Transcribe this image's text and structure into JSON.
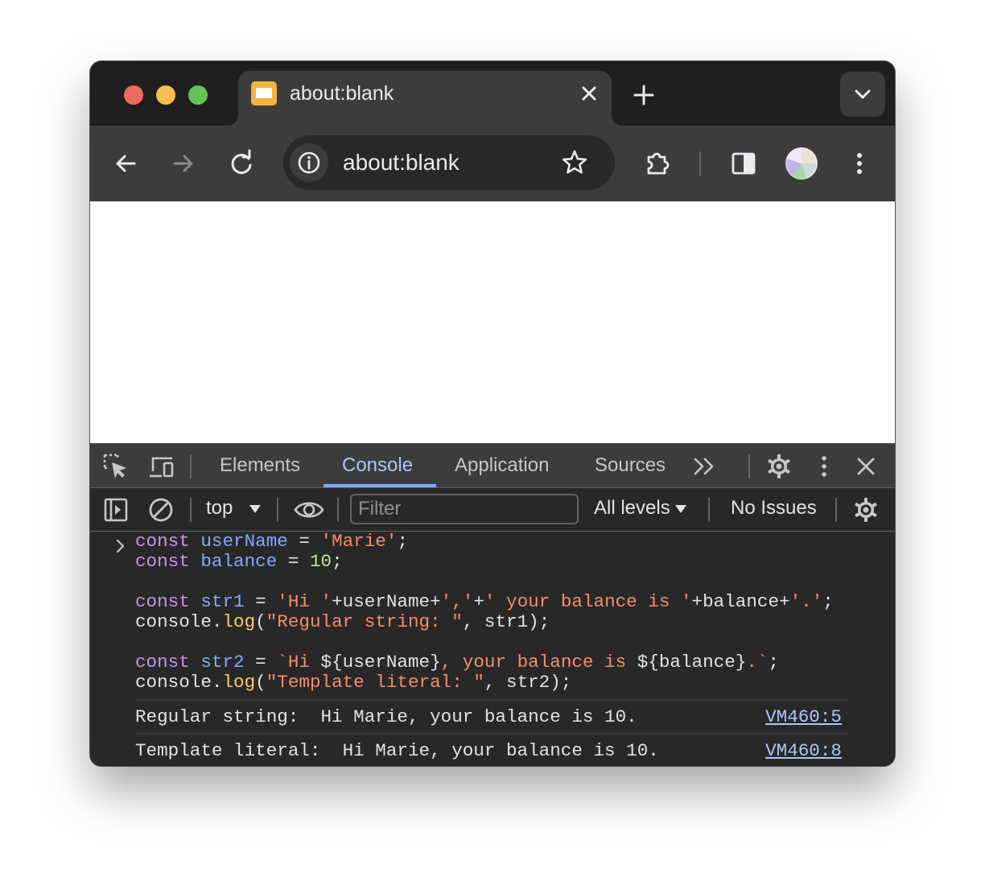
{
  "tab": {
    "title": "about:blank",
    "close_icon": "close-icon"
  },
  "omnibox": {
    "url": "about:blank"
  },
  "devtools": {
    "tabs": [
      "Elements",
      "Console",
      "Application",
      "Sources"
    ],
    "active_tab": "Console",
    "toolbar": {
      "context": "top",
      "filter_placeholder": "Filter",
      "levels": "All levels",
      "issues": "No Issues"
    }
  },
  "console": {
    "outputs": [
      {
        "text": "Regular string:  Hi Marie, your balance is 10.",
        "source": "VM460:5"
      },
      {
        "text": "Template literal:  Hi Marie, your balance is 10.",
        "source": "VM460:8"
      }
    ]
  },
  "colors": {
    "accent": "#7cacf8",
    "keyword": "#c792ea",
    "variable": "#82aaff",
    "string": "#f78c6c",
    "number": "#c3e88d",
    "function": "#ffcb6b"
  }
}
